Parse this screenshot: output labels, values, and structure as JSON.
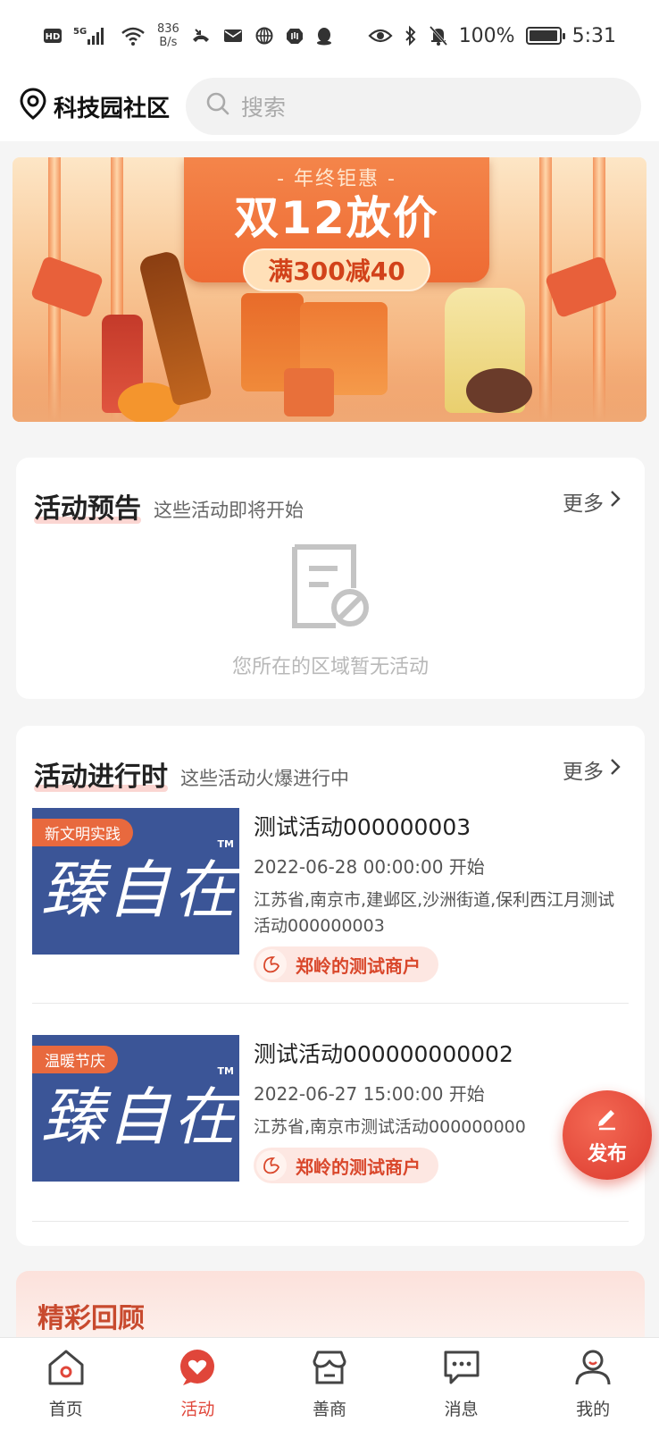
{
  "status_bar": {
    "left_badges": [
      "HD",
      "5G"
    ],
    "net_speed_value": "836",
    "net_speed_unit": "B/s",
    "battery_percent": "100%",
    "battery_level": 1.0,
    "time": "5:31"
  },
  "header": {
    "location": "科技园社区",
    "search_placeholder": "搜索"
  },
  "banner": {
    "pre_title": "- 年终钜惠 -",
    "title": "双12放价",
    "promo": "满300减40"
  },
  "preview_section": {
    "title": "活动预告",
    "subtitle": "这些活动即将开始",
    "more": "更多",
    "empty_text": "您所在的区域暂无活动"
  },
  "ongoing_section": {
    "title": "活动进行时",
    "subtitle": "这些活动火爆进行中",
    "more": "更多",
    "events": [
      {
        "tag": "新文明实践",
        "brand": "臻自在",
        "tm": "TM",
        "title": "测试活动000000003",
        "time": "2022-06-28 00:00:00 开始",
        "address": "江苏省,南京市,建邺区,沙洲街道,保利西江月测试活动000000003",
        "merchant": "郑岭的测试商户"
      },
      {
        "tag": "温暖节庆",
        "brand": "臻自在",
        "tm": "TM",
        "title": "测试活动000000000002",
        "time": "2022-06-27 15:00:00 开始",
        "address": "江苏省,南京市测试活动000000000",
        "merchant": "郑岭的测试商户"
      }
    ]
  },
  "review_section": {
    "title": "精彩回顾"
  },
  "fab": {
    "label": "发布"
  },
  "tabbar": {
    "active_index": 1,
    "accent_color": "#e0463a",
    "tabs": [
      {
        "label": "首页",
        "icon": "home-icon"
      },
      {
        "label": "活动",
        "icon": "activity-heart-icon"
      },
      {
        "label": "善商",
        "icon": "shop-icon"
      },
      {
        "label": "消息",
        "icon": "message-icon"
      },
      {
        "label": "我的",
        "icon": "profile-icon"
      }
    ]
  }
}
